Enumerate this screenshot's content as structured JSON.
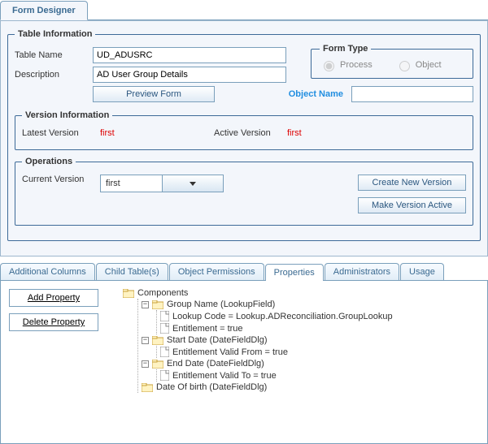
{
  "outer_tab": "Form Designer",
  "table_info": {
    "legend": "Table Information",
    "table_name_label": "Table Name",
    "table_name": "UD_ADUSRC",
    "description_label": "Description",
    "description": "AD User Group Details",
    "preview_button": "Preview Form",
    "form_type_legend": "Form Type",
    "form_type_process": "Process",
    "form_type_object": "Object",
    "object_name_label": "Object Name",
    "object_name": ""
  },
  "version_info": {
    "legend": "Version Information",
    "latest_label": "Latest Version",
    "latest": "first",
    "active_label": "Active Version",
    "active": "first"
  },
  "operations": {
    "legend": "Operations",
    "current_label": "Current Version",
    "current": "first",
    "create_btn": "Create New Version",
    "make_active_btn": "Make Version Active"
  },
  "lower_tabs": {
    "t0": "Additional Columns",
    "t1": "Child Table(s)",
    "t2": "Object Permissions",
    "t3": "Properties",
    "t4": "Administrators",
    "t5": "Usage"
  },
  "prop_buttons": {
    "add": "Add Property",
    "del": "Delete Property"
  },
  "tree": {
    "root": "Components",
    "n0": "Group Name (LookupField)",
    "n0c0": "Lookup Code = Lookup.ADReconciliation.GroupLookup",
    "n0c1": "Entitlement = true",
    "n1": "Start Date (DateFieldDlg)",
    "n1c0": "Entitlement Valid From = true",
    "n2": "End Date (DateFieldDlg)",
    "n2c0": "Entitlement Valid To = true",
    "n3": "Date Of birth (DateFieldDlg)"
  }
}
